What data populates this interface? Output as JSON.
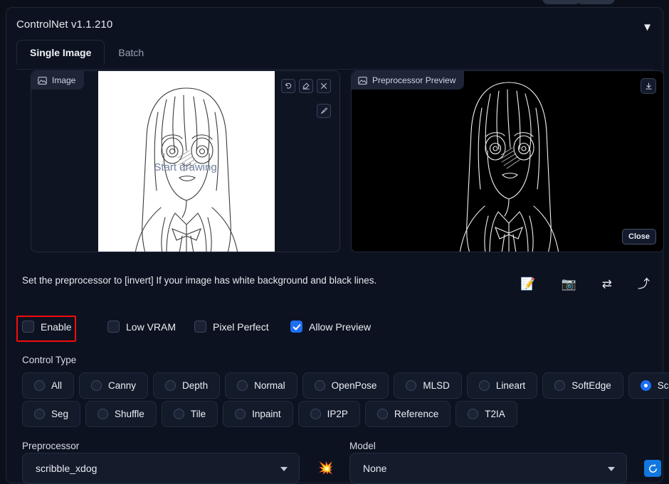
{
  "window": {
    "title": "ControlNet v1.1.210",
    "collapse_icon": "chevron-down-icon",
    "collapse_glyph": "▼"
  },
  "tabs": [
    {
      "label": "Single Image",
      "active": true
    },
    {
      "label": "Batch",
      "active": false
    }
  ],
  "image_panel": {
    "tag_label": "Image",
    "tag_icon": "image-icon",
    "overlay_text": "Start drawing",
    "tools": [
      {
        "name": "undo-button",
        "icon": "undo-icon"
      },
      {
        "name": "erase-button",
        "icon": "eraser-icon"
      },
      {
        "name": "remove-button",
        "icon": "close-icon"
      },
      {
        "name": "brush-button",
        "icon": "brush-icon"
      }
    ]
  },
  "preview_panel": {
    "tag_label": "Preprocessor Preview",
    "tag_icon": "image-icon",
    "download_icon": "download-icon",
    "close_label": "Close"
  },
  "hint": {
    "text": "Set the preprocessor to [invert] If your image has white background and black lines."
  },
  "action_icons": [
    {
      "name": "open-new-canvas-icon",
      "glyph": "📝"
    },
    {
      "name": "webcam-icon",
      "glyph": "📷"
    },
    {
      "name": "mirror-webcam-icon",
      "glyph": "⇄"
    },
    {
      "name": "send-dimensions-icon",
      "glyph": "⤴"
    }
  ],
  "checkboxes": [
    {
      "label": "Enable",
      "checked": false,
      "highlighted": true
    },
    {
      "label": "Low VRAM",
      "checked": false,
      "highlighted": false
    },
    {
      "label": "Pixel Perfect",
      "checked": false,
      "highlighted": false
    },
    {
      "label": "Allow Preview",
      "checked": true,
      "highlighted": false
    }
  ],
  "control_type": {
    "label": "Control Type",
    "row1": [
      {
        "label": "All",
        "selected": false
      },
      {
        "label": "Canny",
        "selected": false
      },
      {
        "label": "Depth",
        "selected": false
      },
      {
        "label": "Normal",
        "selected": false
      },
      {
        "label": "OpenPose",
        "selected": false
      },
      {
        "label": "MLSD",
        "selected": false
      },
      {
        "label": "Lineart",
        "selected": false
      },
      {
        "label": "SoftEdge",
        "selected": false
      },
      {
        "label": "Scribble",
        "selected": true
      }
    ],
    "row2": [
      {
        "label": "Seg",
        "selected": false
      },
      {
        "label": "Shuffle",
        "selected": false
      },
      {
        "label": "Tile",
        "selected": false
      },
      {
        "label": "Inpaint",
        "selected": false
      },
      {
        "label": "IP2P",
        "selected": false
      },
      {
        "label": "Reference",
        "selected": false
      },
      {
        "label": "T2IA",
        "selected": false
      }
    ]
  },
  "preprocessor": {
    "label": "Preprocessor",
    "value": "scribble_xdog",
    "side_icon": "explosion-icon",
    "side_glyph": "💥"
  },
  "model": {
    "label": "Model",
    "value": "None",
    "refresh_icon": "refresh-icon",
    "refresh_glyph": "⟳"
  },
  "colors": {
    "accent": "#1d6ef5",
    "highlight": "#f40c0c",
    "background": "#0b0f19",
    "panel": "#0d1220"
  }
}
